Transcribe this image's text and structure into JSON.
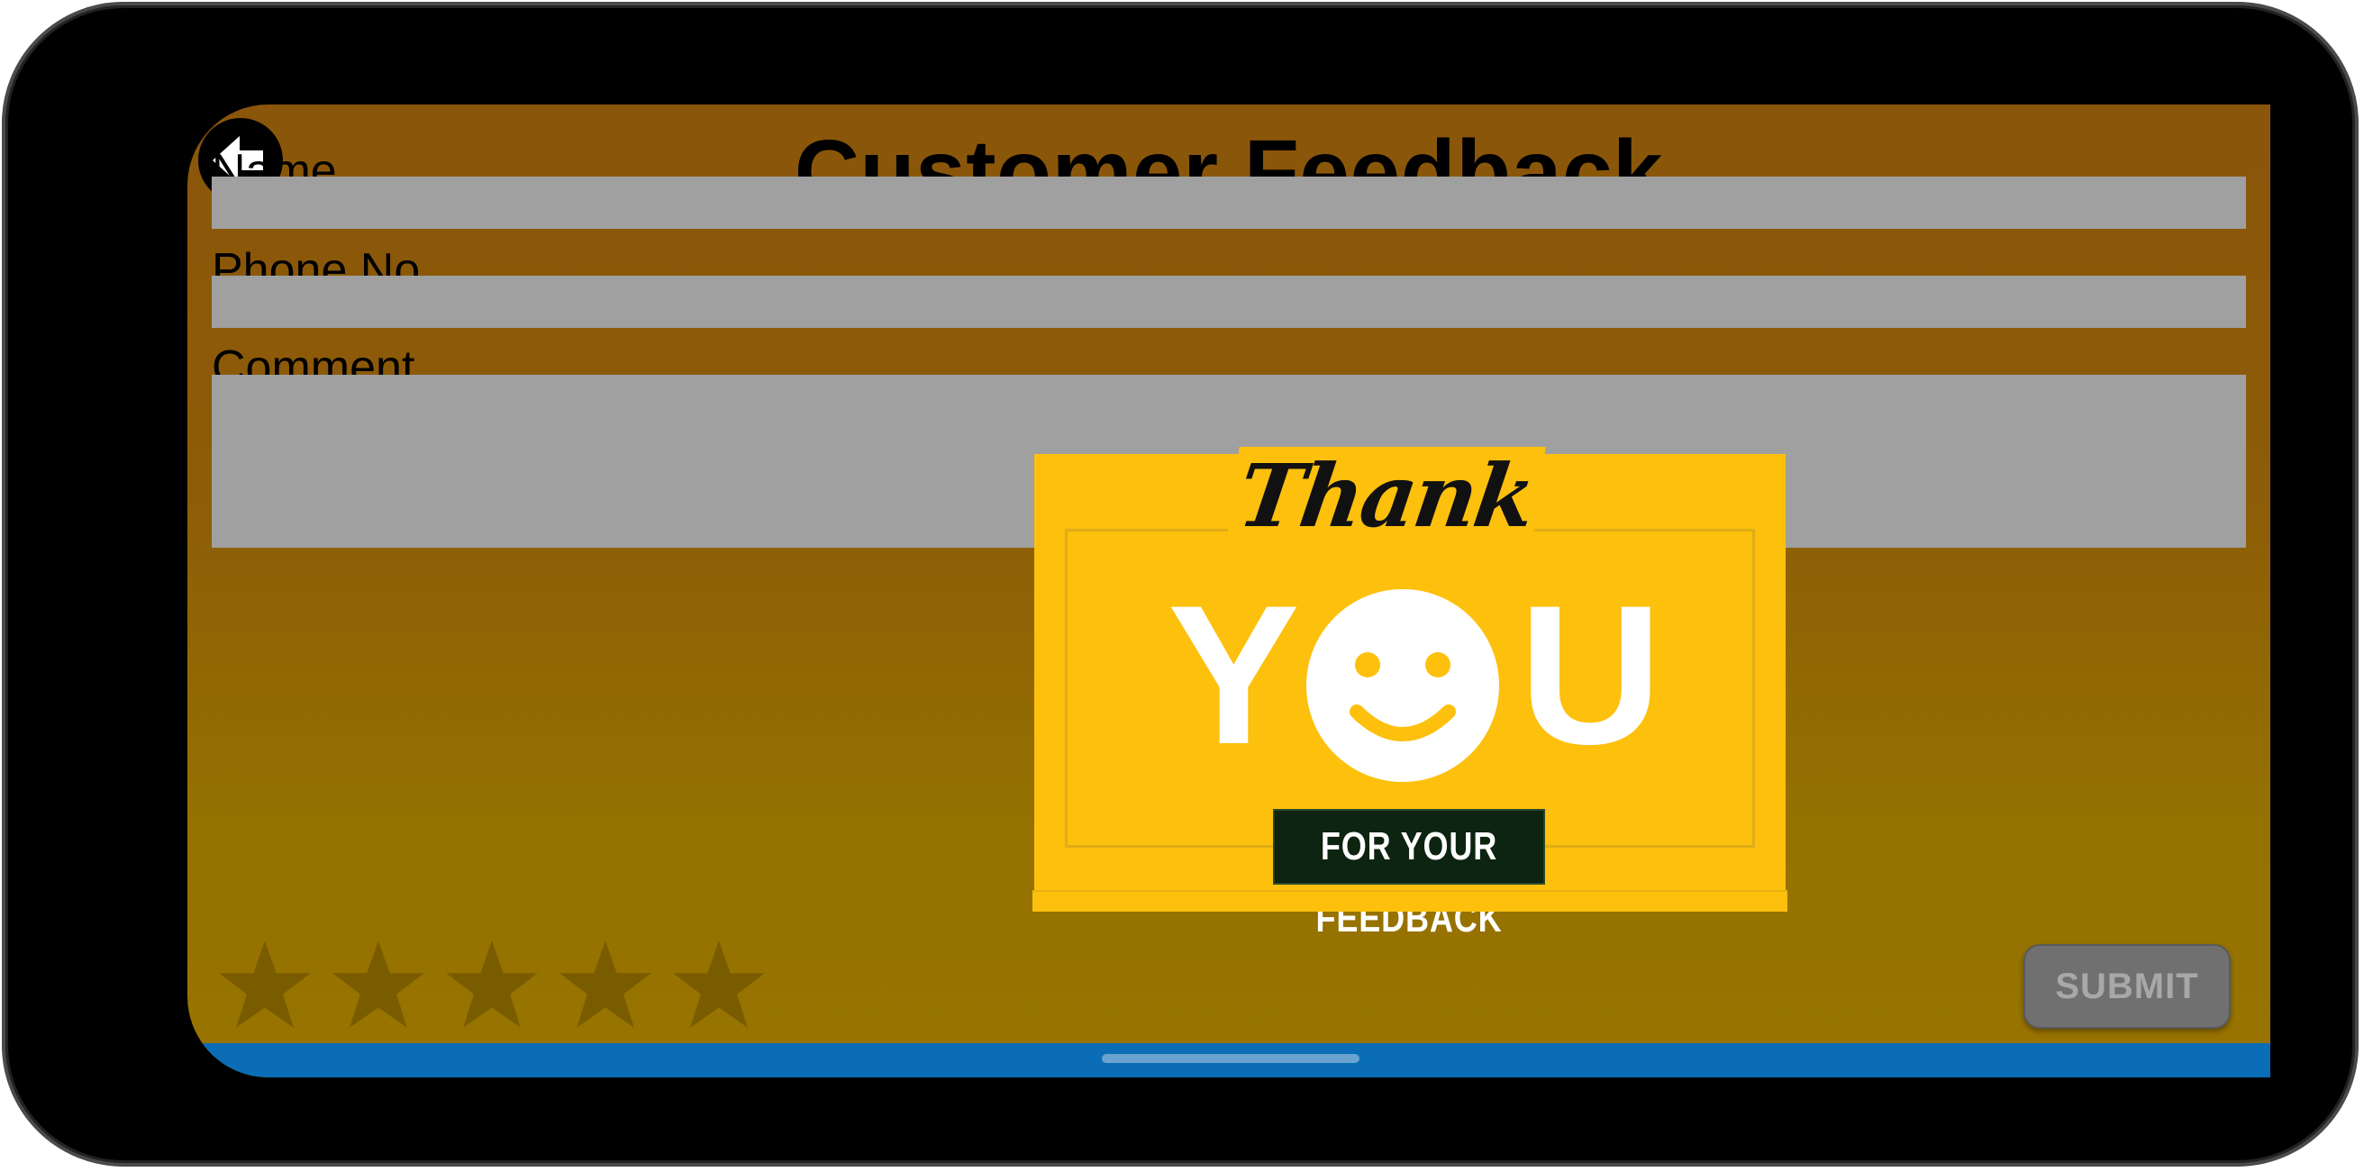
{
  "header": {
    "title": "Customer Feedback",
    "back_icon": "arrow-left-icon"
  },
  "form": {
    "name": {
      "label": "Name",
      "value": "",
      "placeholder": ""
    },
    "phone": {
      "label": "Phone No",
      "value": "",
      "placeholder": ""
    },
    "comment": {
      "label": "Comment",
      "value": "",
      "placeholder": ""
    }
  },
  "rating": {
    "max": 5,
    "value": 0,
    "star_color": "#7a5c00"
  },
  "submit": {
    "label": "SUBMIT",
    "enabled": false
  },
  "dialog": {
    "thank": "Thank",
    "you_left": "Y",
    "you_right": "U",
    "tagline": "FOR YOUR FEEDBACK",
    "background": "#fdc00d",
    "smiley_icon": "smiley-face-icon"
  },
  "navbar": {
    "color": "#0a6db5"
  }
}
